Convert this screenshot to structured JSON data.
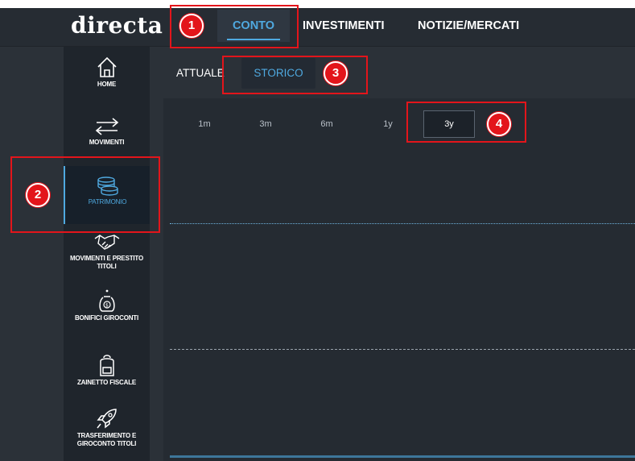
{
  "brand": {
    "logo_text": "directa"
  },
  "top_nav": {
    "items": [
      {
        "label": "CONTO",
        "active": true
      },
      {
        "label": "INVESTIMENTI",
        "active": false
      },
      {
        "label": "NOTIZIE/MERCATI",
        "active": false
      }
    ]
  },
  "sidebar": {
    "items": [
      {
        "label": "HOME",
        "icon": "home-icon"
      },
      {
        "label": "MOVIMENTI",
        "icon": "transfer-arrows-icon"
      },
      {
        "label": "PATRIMONIO",
        "icon": "coins-icon",
        "active": true
      },
      {
        "label": "MOVIMENTI E PRESTITO TITOLI",
        "icon": "handshake-icon"
      },
      {
        "label": "BONIFICI GIROCONTI",
        "icon": "money-bag-icon"
      },
      {
        "label": "ZAINETTO FISCALE",
        "icon": "backpack-icon"
      },
      {
        "label": "TRASFERIMENTO E GIROCONTO TITOLI",
        "icon": "rocket-icon"
      }
    ]
  },
  "sub_tabs": [
    {
      "label": "ATTUALE",
      "active": false
    },
    {
      "label": "STORICO",
      "active": true
    }
  ],
  "ranges": [
    {
      "label": "1m",
      "active": false
    },
    {
      "label": "3m",
      "active": false
    },
    {
      "label": "6m",
      "active": false
    },
    {
      "label": "1y",
      "active": false
    },
    {
      "label": "3y",
      "active": true
    }
  ],
  "annotations": [
    "1",
    "2",
    "3",
    "4"
  ],
  "colors": {
    "accent": "#4fa9e0",
    "callout": "#e3151b",
    "background": "#2b3138"
  }
}
